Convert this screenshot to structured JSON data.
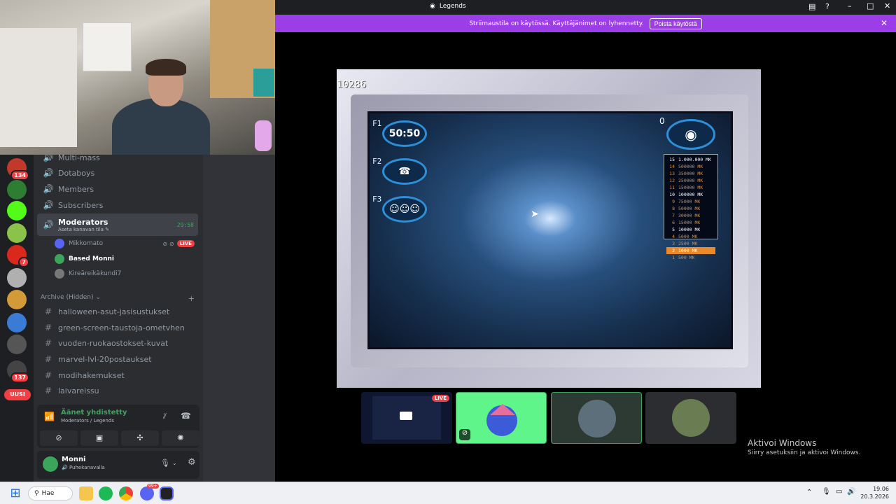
{
  "window": {
    "title": "Legends"
  },
  "banner": {
    "text": "Striimaustila on käytössä. Käyttäjänimet on lyhennetty.",
    "button": "Poista käytöstä"
  },
  "servers": [
    {
      "name": "server-1",
      "badge": "134",
      "color": "#c0392b"
    },
    {
      "name": "server-2",
      "badge": "",
      "color": "#2e7d32"
    },
    {
      "name": "kick",
      "badge": "",
      "color": "#53fc18"
    },
    {
      "name": "server-4",
      "badge": "",
      "color": "#8bc34a"
    },
    {
      "name": "mcdonalds",
      "badge": "7",
      "color": "#da291c"
    },
    {
      "name": "server-6",
      "badge": "",
      "color": "#b0b0b0"
    },
    {
      "name": "server-7",
      "badge": "",
      "color": "#d39a3a"
    },
    {
      "name": "server-8",
      "badge": "",
      "color": "#3a7bd5"
    },
    {
      "name": "server-9",
      "badge": "",
      "color": "#555"
    },
    {
      "name": "server-10",
      "badge": "137",
      "color": "#444"
    }
  ],
  "new_badge": "UUSI",
  "channels_top": [
    "Multi-mass",
    "Dotaboys",
    "Members",
    "Subscribers"
  ],
  "voice_channel": {
    "name": "Moderators",
    "sub": "Aseta kanavan tila",
    "time": "29:58"
  },
  "voice_users": [
    {
      "name": "Mikkomato",
      "live": "LIVE",
      "color": "#5865f2"
    },
    {
      "name": "Based Monni",
      "live": "",
      "color": "#3ba55c"
    },
    {
      "name": "Kireäreikäkundi7",
      "live": "",
      "color": "#777"
    }
  ],
  "category": "Archive (Hidden)",
  "text_channels": [
    "halloween-asut-jasisustukset",
    "green-screen-taustoja-ometvhen",
    "vuoden-ruokaostokset-kuvat",
    "marvel-lvl-20postaukset",
    "modihakemukset",
    "laivareissu"
  ],
  "voice_status": {
    "title": "Äänet yhdistetty",
    "sub": "Moderators / Legends"
  },
  "user": {
    "name": "Monni",
    "status": "Puhekanavalla"
  },
  "game": {
    "score": "10286",
    "question_no": "0",
    "lifelines": [
      {
        "key": "F1",
        "label": "50:50"
      },
      {
        "key": "F2",
        "label": "phone"
      },
      {
        "key": "F3",
        "label": "audience"
      }
    ],
    "money": [
      {
        "n": "15",
        "v": "1.000.000 MK"
      },
      {
        "n": "14",
        "v": "500000 MK"
      },
      {
        "n": "13",
        "v": "350000 MK"
      },
      {
        "n": "12",
        "v": "250000 MK"
      },
      {
        "n": "11",
        "v": "150000 MK"
      },
      {
        "n": "10",
        "v": "100000 MK"
      },
      {
        "n": "9",
        "v": "75000 MK"
      },
      {
        "n": "8",
        "v": "50000 MK"
      },
      {
        "n": "7",
        "v": "30000 MK"
      },
      {
        "n": "6",
        "v": "15000 MK"
      },
      {
        "n": "5",
        "v": "10000 MK"
      },
      {
        "n": "4",
        "v": "5000 MK"
      },
      {
        "n": "3",
        "v": "2500 MK"
      },
      {
        "n": "2",
        "v": "1000 MK"
      },
      {
        "n": "1",
        "v": "500 MK"
      }
    ]
  },
  "tiles": {
    "live_label": "LIVE"
  },
  "windows_notice": {
    "title": "Aktivoi Windows",
    "sub": "Siirry asetuksiin ja aktivoi Windows."
  },
  "taskbar": {
    "search": "Hae",
    "time": "19.06",
    "date": "20.3.2026",
    "discord_badge": "99+"
  }
}
